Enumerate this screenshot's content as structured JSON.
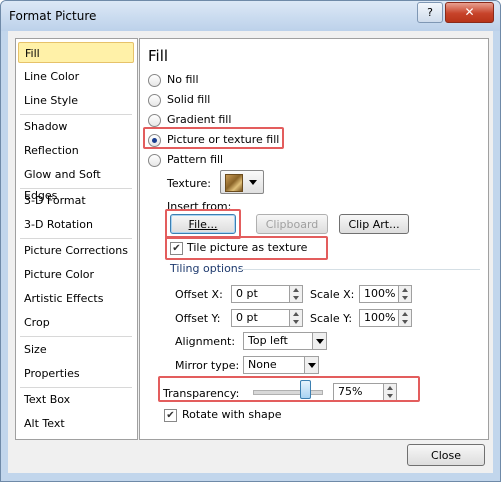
{
  "window": {
    "title": "Format Picture",
    "help": "?",
    "close": "✕"
  },
  "sidebar": {
    "items": [
      {
        "label": "Fill",
        "selected": true
      },
      {
        "label": "Line Color"
      },
      {
        "label": "Line Style"
      },
      {
        "label": "Shadow"
      },
      {
        "label": "Reflection"
      },
      {
        "label": "Glow and Soft Edges"
      },
      {
        "label": "3-D Format"
      },
      {
        "label": "3-D Rotation"
      },
      {
        "label": "Picture Corrections"
      },
      {
        "label": "Picture Color"
      },
      {
        "label": "Artistic Effects"
      },
      {
        "label": "Crop"
      },
      {
        "label": "Size"
      },
      {
        "label": "Properties"
      },
      {
        "label": "Text Box"
      },
      {
        "label": "Alt Text"
      }
    ]
  },
  "fill": {
    "heading": "Fill",
    "options": {
      "no_fill": "No fill",
      "solid_fill": "Solid fill",
      "gradient_fill": "Gradient fill",
      "picture_fill": "Picture or texture fill",
      "pattern_fill": "Pattern fill"
    },
    "selected_option": "Picture or texture fill",
    "texture_label": "Texture:",
    "insert_from_label": "Insert from:",
    "file_button": "File...",
    "clipboard_button": "Clipboard",
    "clipart_button": "Clip Art...",
    "tile_label": "Tile picture as texture",
    "tile_checked": true,
    "tiling_options_label": "Tiling options",
    "offset_x_label": "Offset X:",
    "offset_x_value": "0 pt",
    "offset_y_label": "Offset Y:",
    "offset_y_value": "0 pt",
    "scale_x_label": "Scale X:",
    "scale_x_value": "100%",
    "scale_y_label": "Scale Y:",
    "scale_y_value": "100%",
    "alignment_label": "Alignment:",
    "alignment_value": "Top left",
    "mirror_label": "Mirror type:",
    "mirror_value": "None",
    "transparency_label": "Transparency:",
    "transparency_value": "75%",
    "transparency_fraction": 0.75,
    "rotate_label": "Rotate with shape",
    "rotate_checked": true
  },
  "footer": {
    "close_button": "Close"
  },
  "colors": {
    "highlight": "#e35d5d",
    "nav_selected": "#fff1a8"
  }
}
